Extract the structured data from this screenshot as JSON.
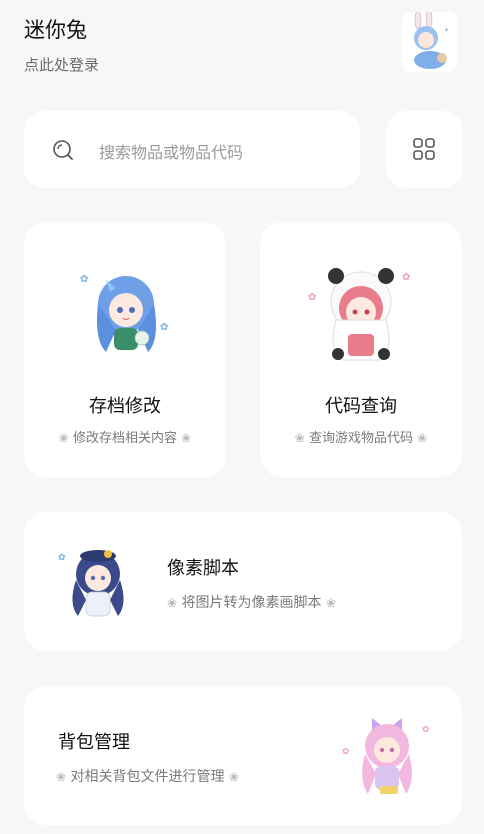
{
  "header": {
    "title": "迷你兔",
    "subtitle": "点此处登录"
  },
  "search": {
    "placeholder": "搜索物品或物品代码"
  },
  "cards": [
    {
      "id": "save-edit",
      "title": "存档修改",
      "desc": "修改存档相关内容"
    },
    {
      "id": "code-query",
      "title": "代码查询",
      "desc": "查询游戏物品代码"
    },
    {
      "id": "pixel-script",
      "title": "像素脚本",
      "desc": "将图片转为像素画脚本"
    },
    {
      "id": "backpack",
      "title": "背包管理",
      "desc": "对相关背包文件进行管理"
    }
  ],
  "decor": {
    "flower": "❀"
  },
  "colors": {
    "background": "#f7f7f7",
    "card": "#ffffff",
    "blue_char": "#5b8fe0",
    "pink_char": "#e87c8a",
    "navy_char": "#3a4a8a",
    "lilac_char": "#f3b8e0"
  }
}
